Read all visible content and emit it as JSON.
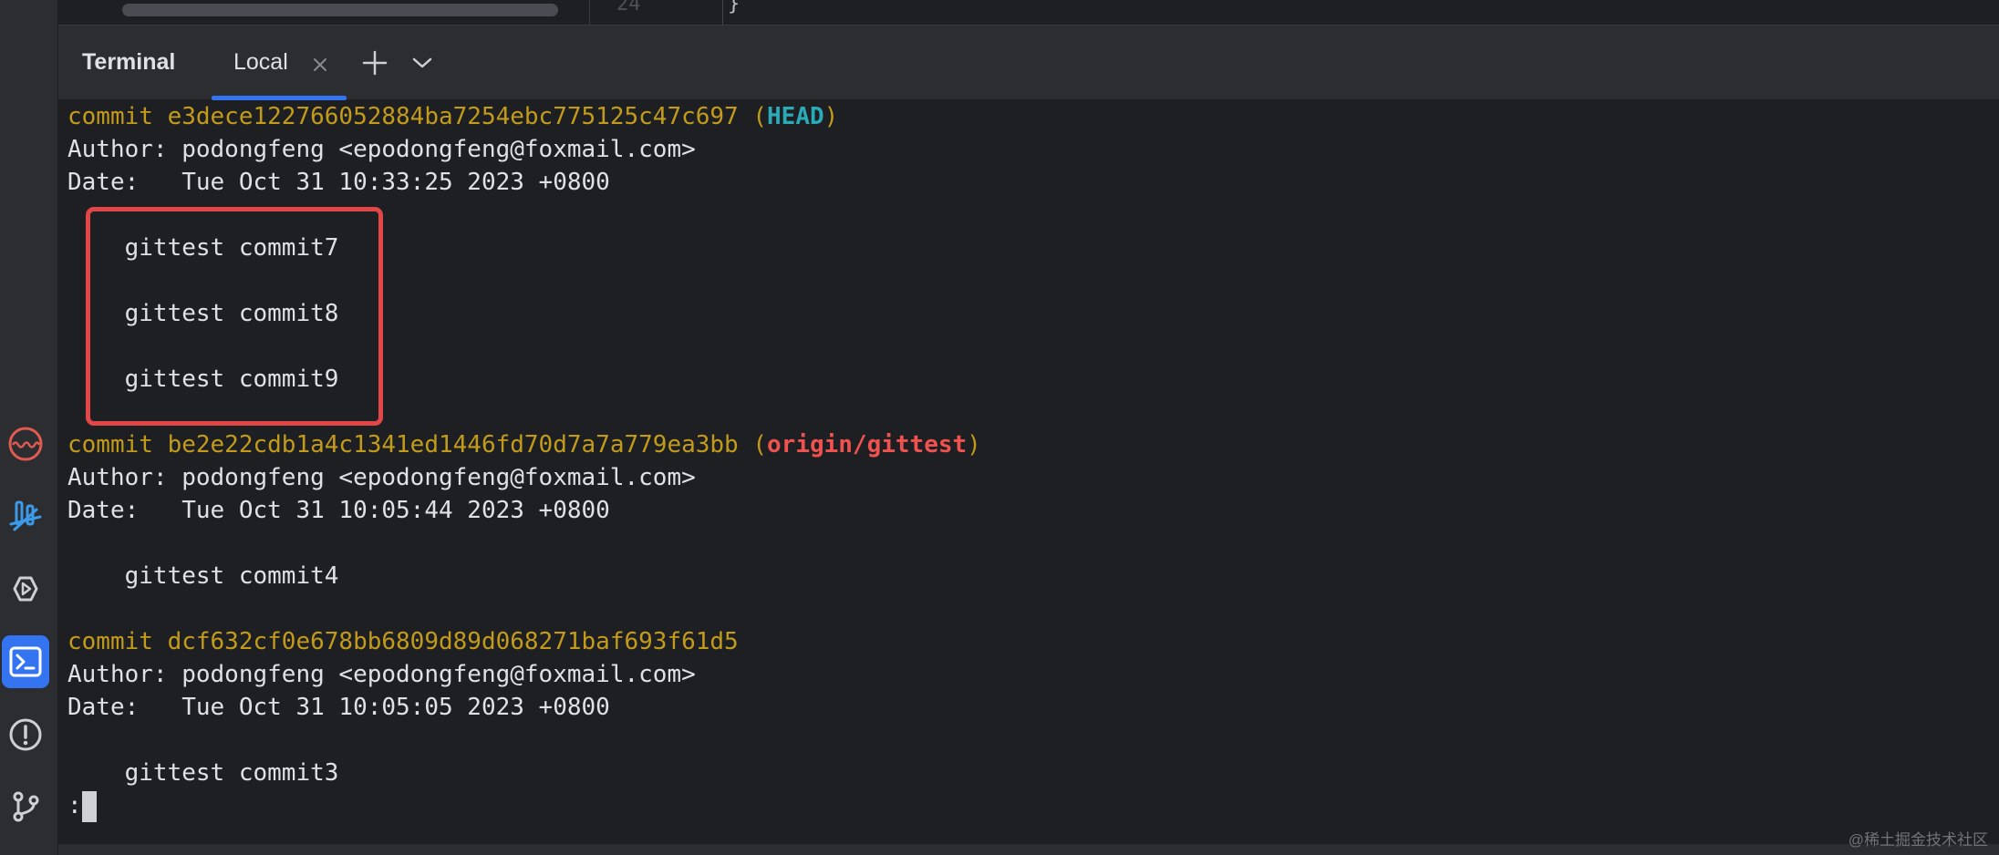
{
  "editor": {
    "line_number": "24",
    "code_text": "}"
  },
  "terminal": {
    "panel_title": "Terminal",
    "tabs": [
      {
        "label": "Local",
        "active": true
      }
    ],
    "icons": {
      "close_tab": "close-icon",
      "add_tab": "plus-icon",
      "dropdown": "chevron-down-icon"
    }
  },
  "left_toolbar": [
    {
      "name": "profiler-icon",
      "color": "#e05a52"
    },
    {
      "name": "services-icon",
      "color": "#3b9be8"
    },
    {
      "name": "run-icon",
      "color": "#ced0d6"
    },
    {
      "name": "terminal-icon",
      "color": "#ffffff",
      "active": true
    },
    {
      "name": "problems-icon",
      "color": "#ced0d6"
    },
    {
      "name": "git-icon",
      "color": "#ced0d6"
    }
  ],
  "colors": {
    "accent": "#3574f0",
    "commit_hash": "#c39b1b",
    "head_ref": "#2aacb8",
    "remote_ref": "#f0524f",
    "highlight_border": "#e14747"
  },
  "log": {
    "c1": {
      "prefix": "commit e3dece122766052884ba7254ebc775125c47c697 (",
      "ref": "HEAD",
      "suffix": ")",
      "author": "Author: podongfeng <epodongfeng@foxmail.com>",
      "date": "Date:   Tue Oct 31 10:33:25 2023 +0800",
      "messages": [
        "    gittest commit7",
        "    gittest commit8",
        "    gittest commit9"
      ]
    },
    "c2": {
      "prefix": "commit be2e22cdb1a4c1341ed1446fd70d7a7a779ea3bb (",
      "ref": "origin/gittest",
      "suffix": ")",
      "author": "Author: podongfeng <epodongfeng@foxmail.com>",
      "date": "Date:   Tue Oct 31 10:05:44 2023 +0800",
      "messages": [
        "    gittest commit4"
      ]
    },
    "c3": {
      "prefix": "commit dcf632cf0e678bb6809d89d068271baf693f61d5",
      "author": "Author: podongfeng <epodongfeng@foxmail.com>",
      "date": "Date:   Tue Oct 31 10:05:05 2023 +0800",
      "messages": [
        "    gittest commit3"
      ]
    },
    "prompt": ":"
  },
  "watermark": "@稀土掘金技术社区"
}
